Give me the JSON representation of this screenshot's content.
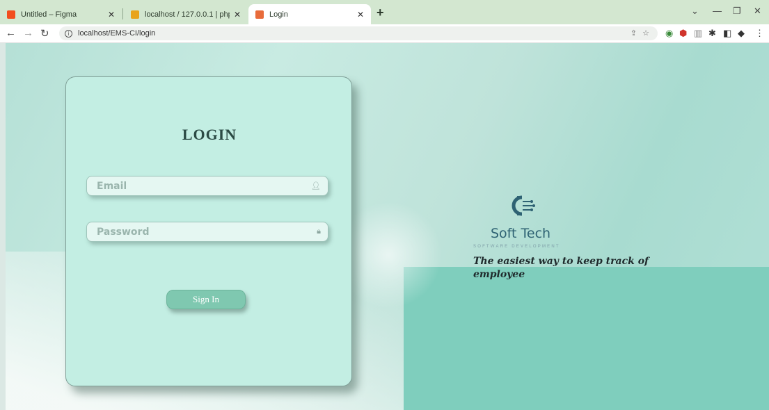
{
  "browser": {
    "tabs": [
      {
        "title": "Untitled – Figma",
        "favicon_color": "#f24e1e"
      },
      {
        "title": "localhost / 127.0.0.1 | phpMyAdm",
        "favicon_color": "#e8a31a"
      },
      {
        "title": "Login",
        "favicon_color": "#e86b3a"
      }
    ],
    "url": "localhost/EMS-CI/login"
  },
  "login": {
    "title": "LOGIN",
    "email_placeholder": "Email",
    "password_placeholder": "Password",
    "signin_label": "Sign In"
  },
  "brand": {
    "name": "Soft Tech",
    "subtitle": "SOFTWARE DEVELOPMENT",
    "tagline": "The easiest way to keep track of employee"
  },
  "colors": {
    "card": "#c3eee3",
    "button": "#7fc8b0",
    "brand_text": "#2e6273"
  }
}
